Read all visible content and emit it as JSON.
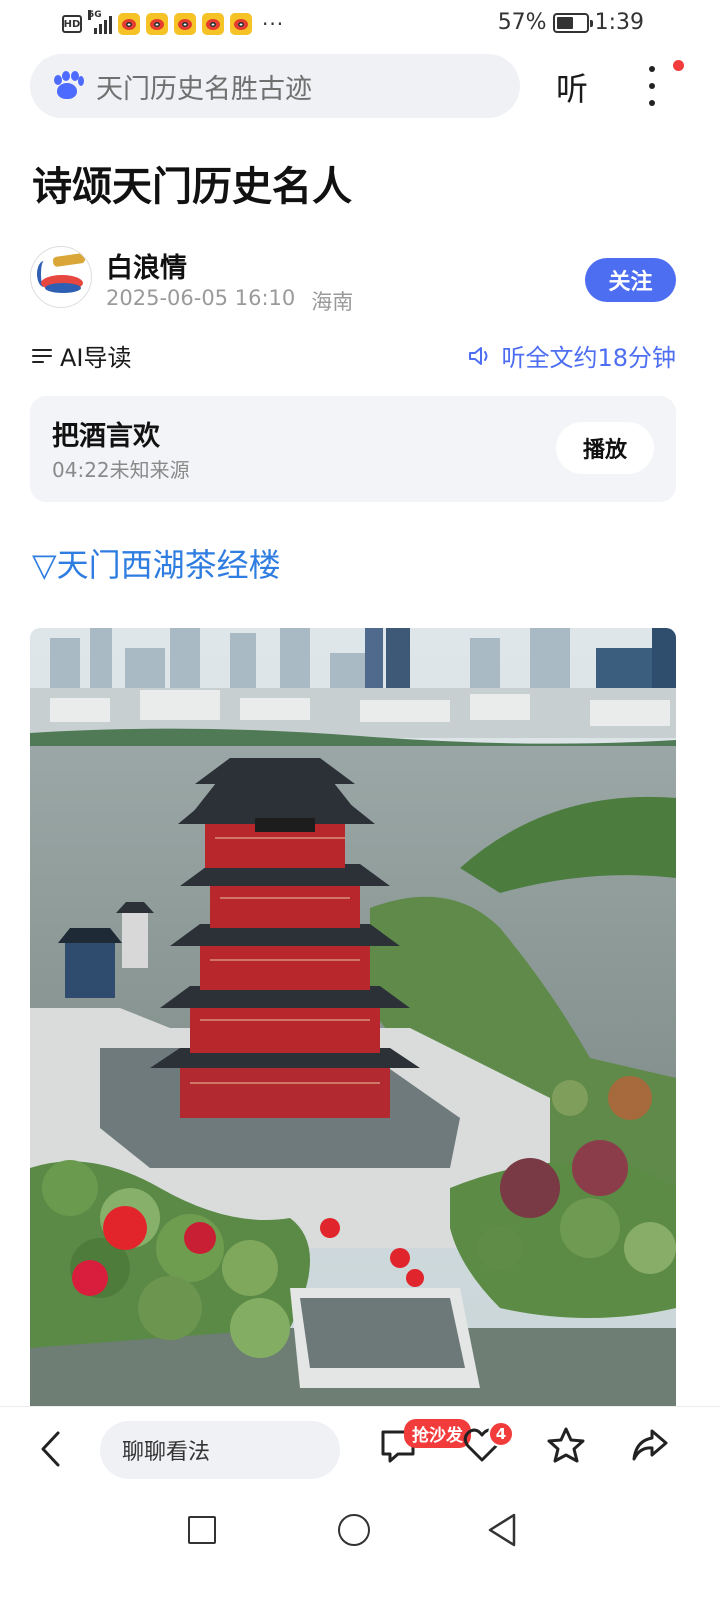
{
  "status_bar": {
    "battery": "57%",
    "time": "1:39",
    "signal_badge": "HD",
    "network": "5G",
    "more": "···"
  },
  "search": {
    "query": "天门历史名胜古迹",
    "listen_label": "听"
  },
  "article": {
    "title": "诗颂天门历史名人",
    "author": "白浪情",
    "datetime": "2025-06-05 16:10",
    "location": "海南",
    "follow_label": "关注",
    "ai_label": "AI导读",
    "listen_all_label": "听全文约18分钟"
  },
  "audio": {
    "title": "把酒言欢",
    "subtitle": "04:22未知来源",
    "play_label": "播放"
  },
  "section_heading": "▽天门西湖茶经楼",
  "bottom_bar": {
    "comment_placeholder": "聊聊看法",
    "sofa_label": "抢沙发",
    "like_count": "4"
  },
  "icons": {
    "brand_color": "#4e6ef2",
    "link_color": "#2f7de1",
    "alert_color": "#f23b3b"
  }
}
